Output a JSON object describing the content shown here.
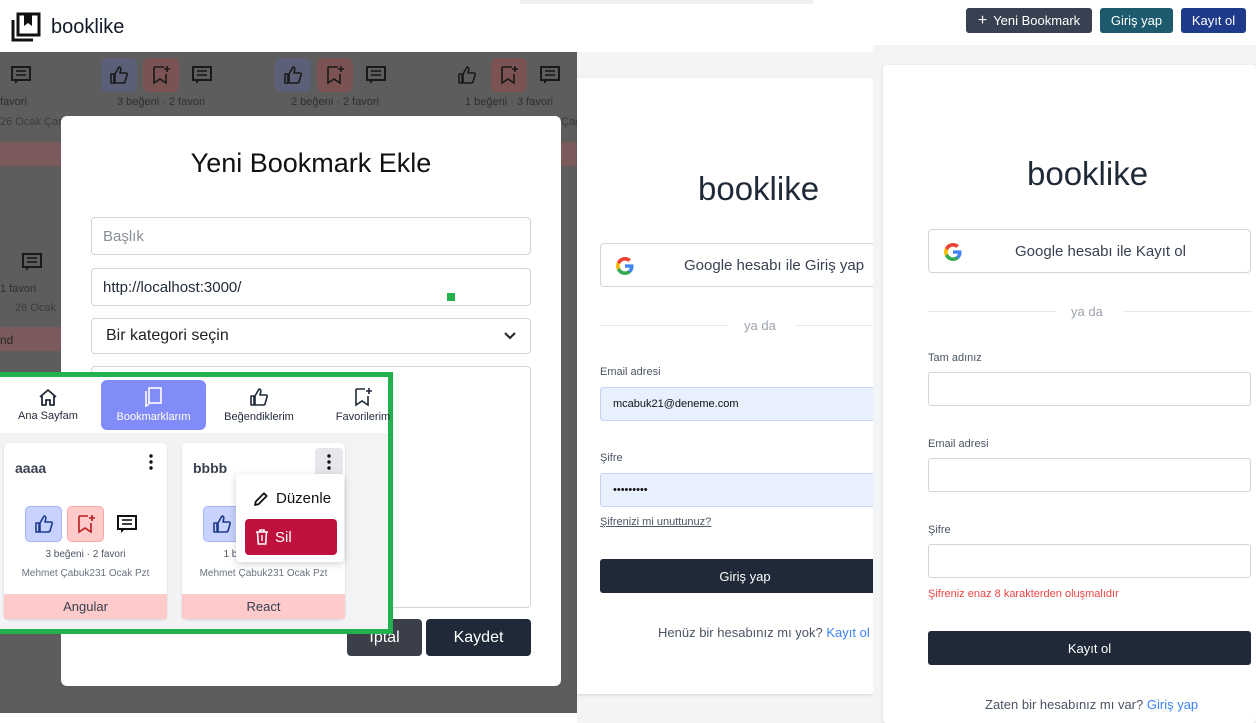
{
  "app": {
    "brand": "booklike"
  },
  "background": {
    "cards": [
      {
        "stats": "favori",
        "date": "26 Ocak Çar"
      },
      {
        "stats": "3 beğeni · 2 favori"
      },
      {
        "stats": "2 beğeni · 2 favori"
      },
      {
        "stats": "1 beğeni · 3 favori",
        "date": "Çar"
      },
      {
        "stats": "1 favori",
        "date": "26 Ocak"
      }
    ],
    "band_text": "nd"
  },
  "modal": {
    "title": "Yeni Bookmark Ekle",
    "title_placeholder": "Başlık",
    "url_value": "http://localhost:3000/",
    "category_value": "Bir kategori seçin",
    "cancel_label": "İptal",
    "save_label": "Kaydet"
  },
  "panel": {
    "nav": [
      {
        "label": "Ana Sayfam",
        "icon": "home-icon"
      },
      {
        "label": "Bookmarklarım",
        "icon": "bookmarks-icon",
        "active": true
      },
      {
        "label": "Beğendiklerim",
        "icon": "thumb-up-icon"
      },
      {
        "label": "Favorilerim",
        "icon": "bookmark-plus-icon"
      }
    ],
    "cards": [
      {
        "title": "aaaa",
        "stats": "3 beğeni · 2 favori",
        "owner": "Mehmet Çabuk231 Ocak Pzt",
        "category": "Angular"
      },
      {
        "title": "bbbb",
        "stats": "1 beğeni · 1 favori",
        "owner": "Mehmet Çabuk231 Ocak Pzt",
        "category": "React"
      }
    ],
    "dropdown": {
      "edit": "Düzenle",
      "delete": "Sil"
    }
  },
  "login": {
    "brand": "booklike",
    "google_label": "Google hesabı ile Giriş yap",
    "or": "ya da",
    "email_label": "Email adresi",
    "email_value": "mcabuk21@deneme.com",
    "password_label": "Şifre",
    "password_value": "•••••••••",
    "forgot": "Şifrenizi mi unuttunuz?",
    "submit": "Giriş yap",
    "footer_text": "Henüz bir hesabınız mı yok?",
    "footer_link": "Kayıt ol"
  },
  "header_buttons": {
    "new_bookmark": "Yeni Bookmark",
    "login": "Giriş yap",
    "register": "Kayıt ol"
  },
  "register": {
    "brand": "booklike",
    "google_label": "Google hesabı ile Kayıt ol",
    "or": "ya da",
    "name_label": "Tam adınız",
    "email_label": "Email adresi",
    "password_label": "Şifre",
    "password_error": "Şifreniz enaz 8 karakterden oluşmalıdır",
    "submit": "Kayıt ol",
    "footer_text": "Zaten bir hesabınız mı var?",
    "footer_link": "Giriş yap"
  },
  "colors": {
    "primary": "#1f2937",
    "active_nav": "#818cf8",
    "danger": "#be123c",
    "highlight_border": "#22b14c",
    "link": "#3b82f6",
    "header_login": "#1e5a6e",
    "header_register": "#1e3a8a"
  }
}
